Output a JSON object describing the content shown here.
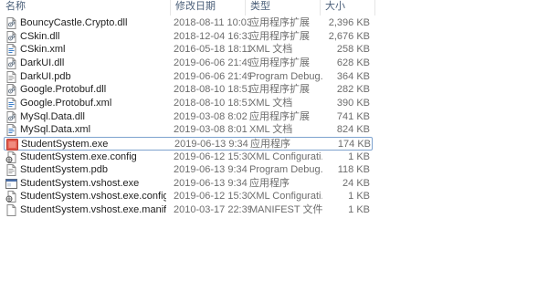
{
  "header": {
    "name_label": "名称",
    "date_label": "修改日期",
    "type_label": "类型",
    "size_label": "大小"
  },
  "files": [
    {
      "name": "BouncyCastle.Crypto.dll",
      "date": "2018-08-11 10:03",
      "type": "应用程序扩展",
      "size": "2,396 KB",
      "icon": "dll-icon"
    },
    {
      "name": "CSkin.dll",
      "date": "2018-12-04 16:33",
      "type": "应用程序扩展",
      "size": "2,676 KB",
      "icon": "dll-icon"
    },
    {
      "name": "CSkin.xml",
      "date": "2016-05-18 18:11",
      "type": "XML 文档",
      "size": "258 KB",
      "icon": "xml-icon"
    },
    {
      "name": "DarkUI.dll",
      "date": "2019-06-06 21:49",
      "type": "应用程序扩展",
      "size": "628 KB",
      "icon": "dll-icon"
    },
    {
      "name": "DarkUI.pdb",
      "date": "2019-06-06 21:49",
      "type": "Program Debug...",
      "size": "364 KB",
      "icon": "pdb-icon"
    },
    {
      "name": "Google.Protobuf.dll",
      "date": "2018-08-10 18:51",
      "type": "应用程序扩展",
      "size": "282 KB",
      "icon": "dll-icon"
    },
    {
      "name": "Google.Protobuf.xml",
      "date": "2018-08-10 18:51",
      "type": "XML 文档",
      "size": "390 KB",
      "icon": "xml-icon"
    },
    {
      "name": "MySql.Data.dll",
      "date": "2019-03-08 8:02",
      "type": "应用程序扩展",
      "size": "741 KB",
      "icon": "dll-icon"
    },
    {
      "name": "MySql.Data.xml",
      "date": "2019-03-08 8:01",
      "type": "XML 文档",
      "size": "824 KB",
      "icon": "xml-icon"
    },
    {
      "name": "StudentSystem.exe",
      "date": "2019-06-13 9:34",
      "type": "应用程序",
      "size": "174 KB",
      "icon": "exe-app-icon",
      "selected": true
    },
    {
      "name": "StudentSystem.exe.config",
      "date": "2019-06-12 15:30",
      "type": "XML Configurati...",
      "size": "1 KB",
      "icon": "config-icon"
    },
    {
      "name": "StudentSystem.pdb",
      "date": "2019-06-13 9:34",
      "type": "Program Debug...",
      "size": "118 KB",
      "icon": "pdb-icon"
    },
    {
      "name": "StudentSystem.vshost.exe",
      "date": "2019-06-13 9:34",
      "type": "应用程序",
      "size": "24 KB",
      "icon": "exe-window-icon"
    },
    {
      "name": "StudentSystem.vshost.exe.config",
      "date": "2019-06-12 15:30",
      "type": "XML Configurati...",
      "size": "1 KB",
      "icon": "config-icon"
    },
    {
      "name": "StudentSystem.vshost.exe.manifest",
      "date": "2010-03-17 22:39",
      "type": "MANIFEST 文件",
      "size": "1 KB",
      "icon": "manifest-icon"
    }
  ],
  "colors": {
    "header_text": "#4c607a",
    "selection_border": "#7da2ce",
    "secondary_text": "#6d6d6d"
  }
}
